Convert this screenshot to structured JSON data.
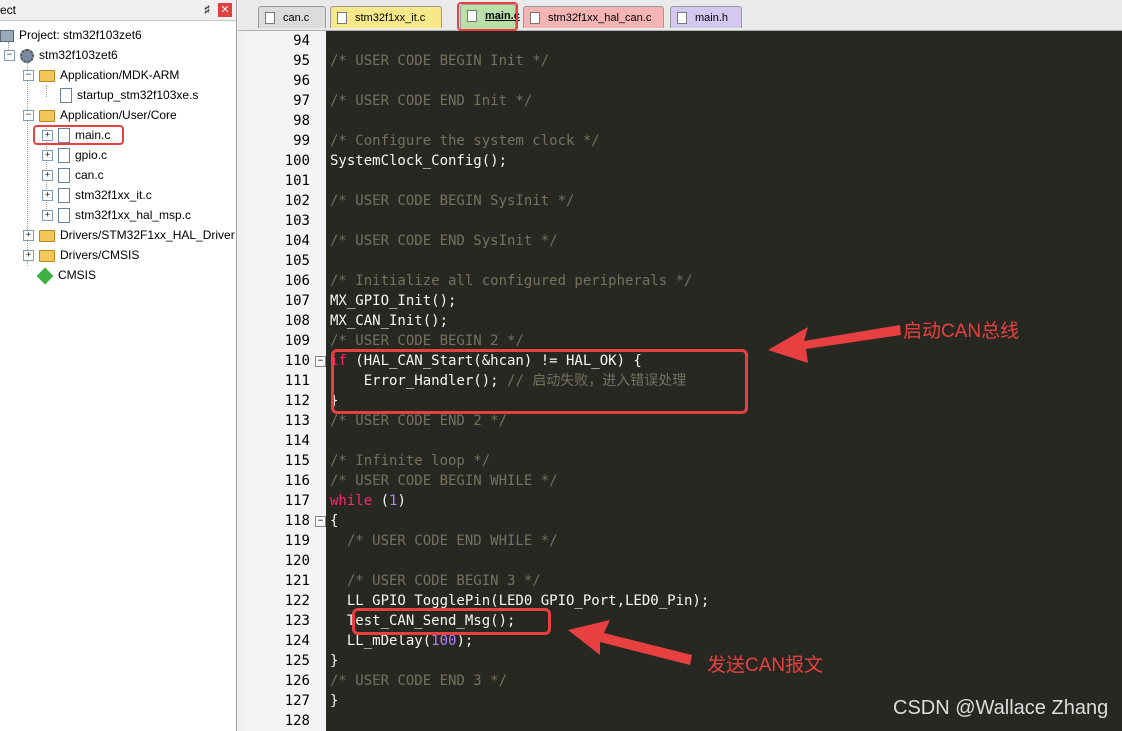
{
  "project_panel": {
    "title": "ect",
    "pin": "♯",
    "close": "✕",
    "tree": [
      {
        "label": "Project: stm32f103zet6",
        "icon": "project-icon"
      },
      {
        "label": "stm32f103zet6",
        "icon": "target-gear-icon"
      },
      {
        "label": "Application/MDK-ARM",
        "icon": "folder-icon"
      },
      {
        "label": "startup_stm32f103xe.s",
        "icon": "file-icon"
      },
      {
        "label": "Application/User/Core",
        "icon": "folder-icon"
      },
      {
        "label": "main.c",
        "icon": "file-icon"
      },
      {
        "label": "gpio.c",
        "icon": "file-icon"
      },
      {
        "label": "can.c",
        "icon": "file-icon"
      },
      {
        "label": "stm32f1xx_it.c",
        "icon": "file-icon"
      },
      {
        "label": "stm32f1xx_hal_msp.c",
        "icon": "file-icon"
      },
      {
        "label": "Drivers/STM32F1xx_HAL_Driver",
        "icon": "folder-icon"
      },
      {
        "label": "Drivers/CMSIS",
        "icon": "folder-icon"
      },
      {
        "label": "CMSIS",
        "icon": "cmsis-diamond-icon"
      }
    ]
  },
  "tabs": [
    {
      "label": "can.c",
      "color": "#dcdcdc"
    },
    {
      "label": "stm32f1xx_it.c",
      "color": "#f7e98a"
    },
    {
      "label": "main.c",
      "color": "#b8e0a8",
      "active": true
    },
    {
      "label": "stm32f1xx_hal_can.c",
      "color": "#f4b4b4"
    },
    {
      "label": "main.h",
      "color": "#d4c8f0"
    }
  ],
  "code": {
    "line_numbers": [
      "94",
      "95",
      "96",
      "97",
      "98",
      "99",
      "100",
      "101",
      "102",
      "103",
      "104",
      "105",
      "106",
      "107",
      "108",
      "109",
      "110",
      "111",
      "112",
      "113",
      "114",
      "115",
      "116",
      "117",
      "118",
      "119",
      "120",
      "121",
      "122",
      "123",
      "124",
      "125",
      "126",
      "127",
      "128"
    ],
    "lines": [
      "",
      "/* USER CODE BEGIN Init */",
      "",
      "/* USER CODE END Init */",
      "",
      "/* Configure the system clock */",
      "SystemClock_Config();",
      "",
      "/* USER CODE BEGIN SysInit */",
      "",
      "/* USER CODE END SysInit */",
      "",
      "/* Initialize all configured peripherals */",
      "MX_GPIO_Init();",
      "MX_CAN_Init();",
      "/* USER CODE BEGIN 2 */",
      "if (HAL_CAN_Start(&hcan) != HAL_OK) {",
      "    Error_Handler(); // 启动失败，进入错误处理",
      "}",
      "/* USER CODE END 2 */",
      "",
      "/* Infinite loop */",
      "/* USER CODE BEGIN WHILE */",
      "while (1)",
      "{",
      "  /* USER CODE END WHILE */",
      "",
      "  /* USER CODE BEGIN 3 */",
      "  LL_GPIO_TogglePin(LED0_GPIO_Port,LED0_Pin);",
      "  Test_CAN_Send_Msg();",
      "  LL_mDelay(100);",
      "}",
      "/* USER CODE END 3 */",
      "}",
      ""
    ]
  },
  "annotations": {
    "start_can": "启动CAN总线",
    "send_can": "发送CAN报文"
  },
  "watermark": "CSDN @Wallace Zhang"
}
